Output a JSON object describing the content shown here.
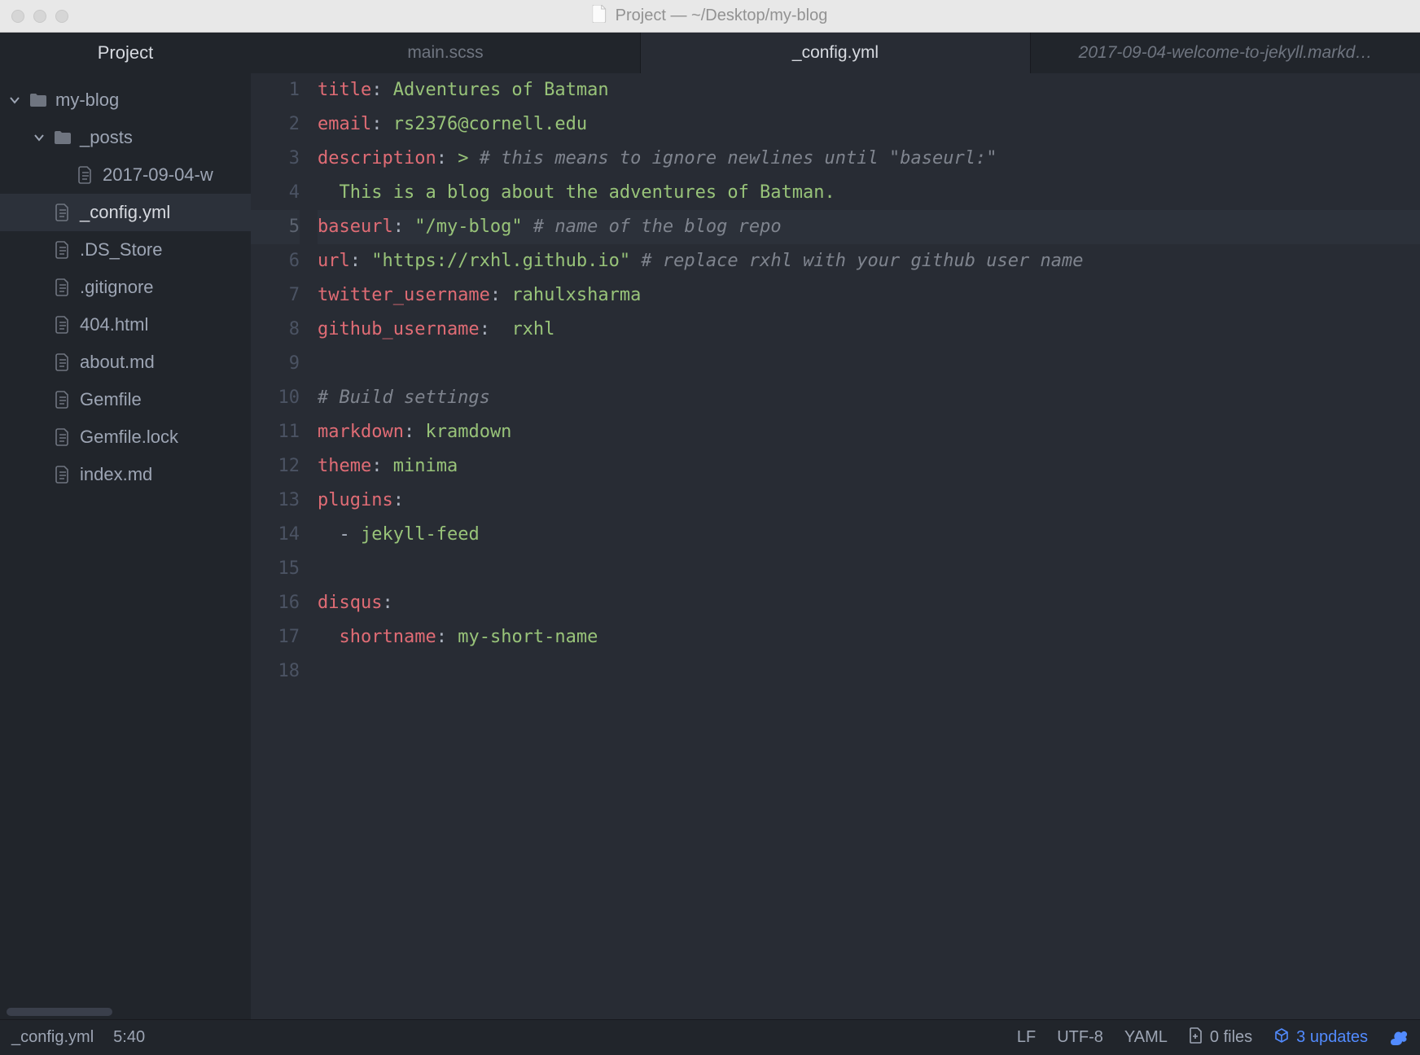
{
  "titlebar": {
    "title": "Project — ~/Desktop/my-blog"
  },
  "sidebar": {
    "title": "Project",
    "tree": [
      {
        "label": "my-blog",
        "type": "folder",
        "indent": 0,
        "expanded": true
      },
      {
        "label": "_posts",
        "type": "folder",
        "indent": 1,
        "expanded": true
      },
      {
        "label": "2017-09-04-w",
        "type": "file",
        "indent": 2
      },
      {
        "label": "_config.yml",
        "type": "file",
        "indent": 1,
        "selected": true
      },
      {
        "label": ".DS_Store",
        "type": "file",
        "indent": 1
      },
      {
        "label": ".gitignore",
        "type": "file",
        "indent": 1
      },
      {
        "label": "404.html",
        "type": "file",
        "indent": 1
      },
      {
        "label": "about.md",
        "type": "file",
        "indent": 1
      },
      {
        "label": "Gemfile",
        "type": "file",
        "indent": 1
      },
      {
        "label": "Gemfile.lock",
        "type": "file",
        "indent": 1
      },
      {
        "label": "index.md",
        "type": "file",
        "indent": 1
      }
    ]
  },
  "tabs": [
    {
      "label": "main.scss",
      "active": false,
      "italic": false
    },
    {
      "label": "_config.yml",
      "active": true,
      "italic": false
    },
    {
      "label": "2017-09-04-welcome-to-jekyll.markd…",
      "active": false,
      "italic": true
    }
  ],
  "editor": {
    "current_line": 5,
    "lines": [
      {
        "n": 1,
        "tokens": [
          [
            "k",
            "title"
          ],
          [
            "c",
            ": "
          ],
          [
            "s",
            "Adventures of Batman"
          ]
        ]
      },
      {
        "n": 2,
        "tokens": [
          [
            "k",
            "email"
          ],
          [
            "c",
            ": "
          ],
          [
            "s",
            "rs2376@cornell.edu"
          ]
        ]
      },
      {
        "n": 3,
        "tokens": [
          [
            "k",
            "description"
          ],
          [
            "c",
            ": "
          ],
          [
            "s",
            "> "
          ],
          [
            "cm",
            "# this means to ignore newlines until \"baseurl:\""
          ]
        ]
      },
      {
        "n": 4,
        "tokens": [
          [
            "p",
            "  "
          ],
          [
            "s",
            "This is a blog about the adventures of Batman."
          ]
        ]
      },
      {
        "n": 5,
        "tokens": [
          [
            "k",
            "baseurl"
          ],
          [
            "c",
            ": "
          ],
          [
            "s",
            "\"/my-blog\" "
          ],
          [
            "cm",
            "# name of the blog repo"
          ]
        ]
      },
      {
        "n": 6,
        "tokens": [
          [
            "k",
            "url"
          ],
          [
            "c",
            ": "
          ],
          [
            "s",
            "\"https://rxhl.github.io\" "
          ],
          [
            "cm",
            "# replace rxhl with your github user name"
          ]
        ]
      },
      {
        "n": 7,
        "tokens": [
          [
            "k",
            "twitter_username"
          ],
          [
            "c",
            ": "
          ],
          [
            "s",
            "rahulxsharma"
          ]
        ]
      },
      {
        "n": 8,
        "tokens": [
          [
            "k",
            "github_username"
          ],
          [
            "c",
            ":  "
          ],
          [
            "s",
            "rxhl"
          ]
        ]
      },
      {
        "n": 9,
        "tokens": []
      },
      {
        "n": 10,
        "tokens": [
          [
            "cm",
            "# Build settings"
          ]
        ]
      },
      {
        "n": 11,
        "tokens": [
          [
            "k",
            "markdown"
          ],
          [
            "c",
            ": "
          ],
          [
            "s",
            "kramdown"
          ]
        ]
      },
      {
        "n": 12,
        "tokens": [
          [
            "k",
            "theme"
          ],
          [
            "c",
            ": "
          ],
          [
            "s",
            "minima"
          ]
        ]
      },
      {
        "n": 13,
        "tokens": [
          [
            "k",
            "plugins"
          ],
          [
            "c",
            ":"
          ]
        ]
      },
      {
        "n": 14,
        "tokens": [
          [
            "p",
            "  "
          ],
          [
            "c",
            "- "
          ],
          [
            "s",
            "jekyll-feed"
          ]
        ]
      },
      {
        "n": 15,
        "tokens": []
      },
      {
        "n": 16,
        "tokens": [
          [
            "k",
            "disqus"
          ],
          [
            "c",
            ":"
          ]
        ]
      },
      {
        "n": 17,
        "tokens": [
          [
            "p",
            "  "
          ],
          [
            "k",
            "shortname"
          ],
          [
            "c",
            ": "
          ],
          [
            "s",
            "my-short-name"
          ]
        ]
      },
      {
        "n": 18,
        "tokens": []
      }
    ]
  },
  "statusbar": {
    "filename": "_config.yml",
    "cursor": "5:40",
    "line_ending": "LF",
    "encoding": "UTF-8",
    "language": "YAML",
    "files": "0 files",
    "updates": "3 updates"
  }
}
